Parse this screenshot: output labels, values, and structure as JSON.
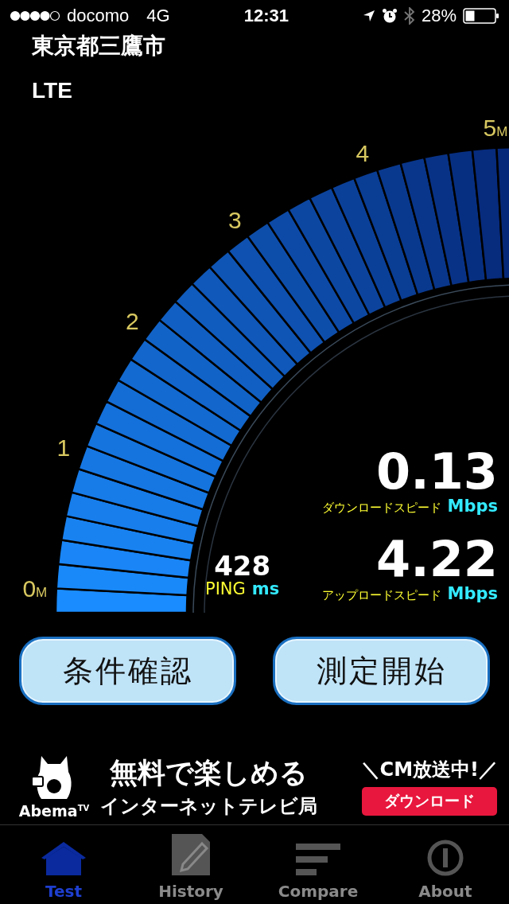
{
  "status_bar": {
    "carrier": "docomo",
    "network": "4G",
    "time": "12:31",
    "battery": "28%"
  },
  "location": "東京都三鷹市",
  "connection": "LTE",
  "gauge": {
    "ticks": [
      {
        "number": "0",
        "unit": "M"
      },
      {
        "number": "1"
      },
      {
        "number": "2"
      },
      {
        "number": "3"
      },
      {
        "number": "4"
      },
      {
        "number": "5",
        "unit": "M"
      }
    ]
  },
  "readings": {
    "download": {
      "value": "0.13",
      "label": "ダウンロードスピード",
      "unit": "Mbps"
    },
    "upload": {
      "value": "4.22",
      "label": "アップロードスピード",
      "unit": "Mbps"
    },
    "ping": {
      "value": "428",
      "label": "PING",
      "unit": "ms"
    }
  },
  "buttons": [
    "条件確認",
    "測定開始"
  ],
  "ad": {
    "brand": "Abema",
    "brand_suffix": "TV",
    "headline": "無料で楽しめる",
    "subline": "インターネットテレビ局",
    "tagline": "＼CM放送中!／",
    "button": "ダウンロード"
  },
  "tabs": [
    {
      "label": "Test",
      "selected": true,
      "kind": "house"
    },
    {
      "label": "History",
      "selected": false,
      "kind": "notepad"
    },
    {
      "label": "Compare",
      "selected": false,
      "kind": "bars"
    },
    {
      "label": "About",
      "selected": false,
      "kind": "info"
    }
  ]
}
